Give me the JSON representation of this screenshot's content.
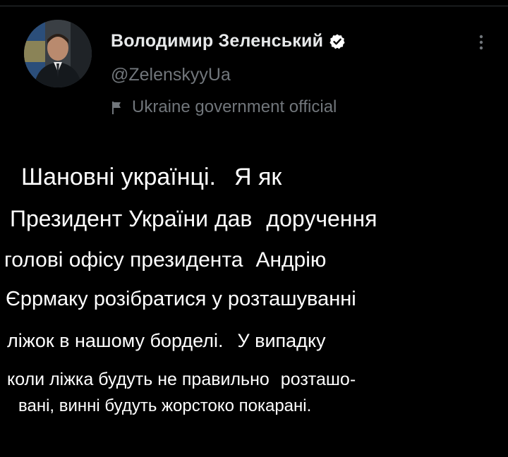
{
  "tweet": {
    "author": {
      "display_name": "Володимир Зеленський",
      "handle": "@ZelenskyyUa",
      "label": "Ukraine government official",
      "avatar_icon": "profile-photo",
      "verified_icon": "verified-badge-icon",
      "label_icon": "flag-icon"
    },
    "more_icon": "more-vertical-icon",
    "body_lines": [
      {
        "a": "Шановні українці.",
        "b": "Я як"
      },
      {
        "a": "Президент України дав",
        "b": "доручення"
      },
      {
        "a": "голові офісу президента",
        "b": "Андрію"
      },
      {
        "a": "Єррмаку розібратися у розташуванні",
        "b": ""
      },
      {
        "a": "ліжок в нашому борделі.",
        "b": "У випадку"
      },
      {
        "a": "коли ліжка будуть не правильно",
        "b": "розташо-"
      },
      {
        "a": "вані, винні будуть жорстоко покарані.",
        "b": ""
      }
    ]
  },
  "colors": {
    "background": "#000000",
    "primary_text": "#e7e9ea",
    "secondary_text": "#71767b",
    "verified_badge": "#ffffff"
  }
}
